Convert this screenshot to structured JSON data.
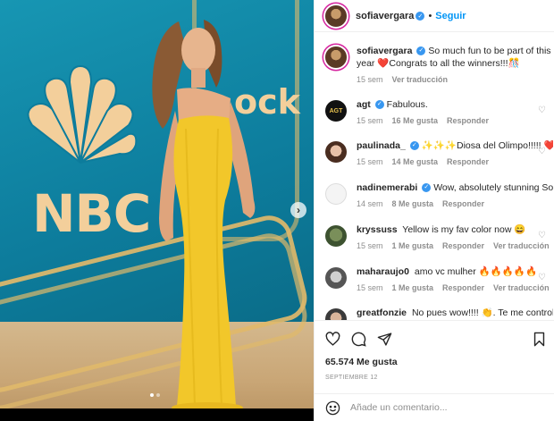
{
  "photo": {
    "wall_text": "NBC",
    "partial_brand_text": "ock",
    "carousel_next_icon": "chevron-right-icon",
    "carousel_dots": 2,
    "carousel_active_index": 0
  },
  "header": {
    "username": "sofiavergara",
    "separator": "•",
    "follow_label": "Seguir"
  },
  "comments": [
    {
      "user": "sofiavergara",
      "verified": true,
      "text": "So much fun to be part of this year ❤️Congrats to all the winners!!!🎊",
      "time": "15 sem",
      "likes": "",
      "reply": "",
      "translate": "Ver traducción"
    },
    {
      "user": "agt",
      "verified": true,
      "text": "Fabulous.",
      "time": "15 sem",
      "likes": "16 Me gusta",
      "reply": "Responder",
      "translate": ""
    },
    {
      "user": "paulinada_",
      "verified": true,
      "text": "✨✨✨Diosa del Olimpo!!!!! ❤️",
      "time": "15 sem",
      "likes": "14 Me gusta",
      "reply": "Responder",
      "translate": ""
    },
    {
      "user": "nadinemerabi",
      "verified": true,
      "text": "Wow, absolutely stunning Sofia!",
      "time": "14 sem",
      "likes": "8 Me gusta",
      "reply": "Responder",
      "translate": ""
    },
    {
      "user": "kryssuss",
      "verified": false,
      "text": "Yellow is my fav color now 😄",
      "time": "15 sem",
      "likes": "1 Me gusta",
      "reply": "Responder",
      "translate": "Ver traducción"
    },
    {
      "user": "maharaujo0",
      "verified": false,
      "text": "amo vc mulher 🔥🔥🔥🔥🔥",
      "time": "15 sem",
      "likes": "1 Me gusta",
      "reply": "Responder",
      "translate": "Ver traducción"
    },
    {
      "user": "greatfonzie",
      "verified": false,
      "text": "No pues wow!!!! 👏. Te me controlas",
      "time": "",
      "likes": "",
      "reply": "",
      "translate": ""
    }
  ],
  "actions": {
    "like_icon": "heart-icon",
    "comment_icon": "comment-icon",
    "share_icon": "send-icon",
    "save_icon": "bookmark-icon",
    "likes_count": "65.574 Me gusta",
    "date": "SEPTIEMBRE 12"
  },
  "add_comment": {
    "placeholder": "Añade un comentario...",
    "emoji_icon": "emoji-icon"
  },
  "colors": {
    "accent": "#0095f6",
    "verified": "#3897f0",
    "muted": "#8e8e8e",
    "text": "#262626",
    "dress": "#f2c72a"
  }
}
